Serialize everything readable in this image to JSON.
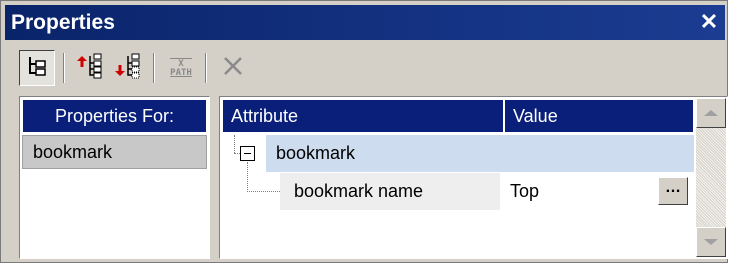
{
  "window": {
    "title": "Properties",
    "close_glyph": "✕"
  },
  "toolbar": {
    "buttons": [
      {
        "icon": "tree-view-icon",
        "pressed": true
      },
      {
        "icon": "insert-element-before-icon"
      },
      {
        "icon": "append-element-after-icon"
      },
      {
        "icon": "xpath-icon",
        "label_top": "X",
        "label_bottom": "PATH",
        "disabled": true
      },
      {
        "icon": "delete-icon",
        "disabled": true
      }
    ]
  },
  "properties_for": {
    "header": "Properties For:",
    "items": [
      "bookmark"
    ]
  },
  "grid": {
    "columns": {
      "attribute": "Attribute",
      "value": "Value"
    },
    "group_label": "bookmark",
    "rows": [
      {
        "attribute": "bookmark name",
        "value": "Top",
        "button_label": "…"
      }
    ]
  },
  "colors": {
    "title_bar": "#0a246a",
    "header_bg": "#0a1f7a",
    "selected_row": "#cddcee",
    "chrome": "#d4d0c8"
  }
}
